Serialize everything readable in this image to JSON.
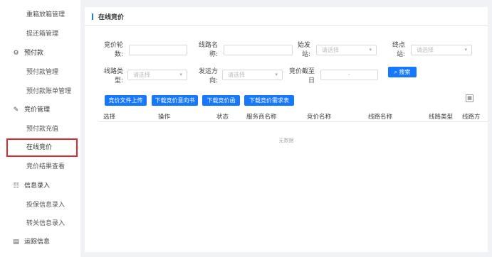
{
  "sidebar": {
    "items": [
      {
        "label": "重箱放箱管理",
        "kind": "sub"
      },
      {
        "label": "提还箱管理",
        "kind": "sub"
      },
      {
        "label": "预付款",
        "kind": "group",
        "icon": "gear-icon"
      },
      {
        "label": "预付款管理",
        "kind": "sub"
      },
      {
        "label": "预付款账单管理",
        "kind": "sub"
      },
      {
        "label": "竞价管理",
        "kind": "group",
        "icon": "edit-icon"
      },
      {
        "label": "预付款充值",
        "kind": "sub"
      },
      {
        "label": "在线竞价",
        "kind": "sub",
        "active": true
      },
      {
        "label": "竞价结果查看",
        "kind": "sub"
      },
      {
        "label": "信息录入",
        "kind": "group",
        "icon": "form-icon"
      },
      {
        "label": "投保信息录入",
        "kind": "sub"
      },
      {
        "label": "转关信息录入",
        "kind": "sub"
      },
      {
        "label": "运踪信息",
        "kind": "group",
        "icon": "doc-icon"
      }
    ]
  },
  "page": {
    "title": "在线竞价"
  },
  "filters": {
    "round_label_1": "竞价轮",
    "round_label_2": "数:",
    "route_name_label_1": "线路名",
    "route_name_label_2": "称:",
    "origin_label_1": "始发",
    "origin_label_2": "站:",
    "origin_placeholder": "请选择",
    "dest_label_1": "终点",
    "dest_label_2": "站:",
    "dest_placeholder": "请选择",
    "route_type_label_1": "线路类",
    "route_type_label_2": "型:",
    "route_type_placeholder": "请选择",
    "ship_dir_label_1": "发运方",
    "ship_dir_label_2": "向:",
    "ship_dir_placeholder": "请选择",
    "deadline_label_1": "竞价截至",
    "deadline_label_2": "日",
    "deadline_separator": "-",
    "search_label": "搜索"
  },
  "actions": {
    "upload": "竞价文件上传",
    "download_intent": "下载竞价意向书",
    "download_letter": "下载竞价函",
    "download_demand": "下载竞价需求表"
  },
  "table": {
    "columns": [
      "选择",
      "操作",
      "状态",
      "服务商名称",
      "竞价名称",
      "线路名称",
      "线路类型",
      "线路方"
    ],
    "empty_text": "无数据"
  },
  "colors": {
    "accent": "#1677ff",
    "highlight": "#e0292b"
  }
}
